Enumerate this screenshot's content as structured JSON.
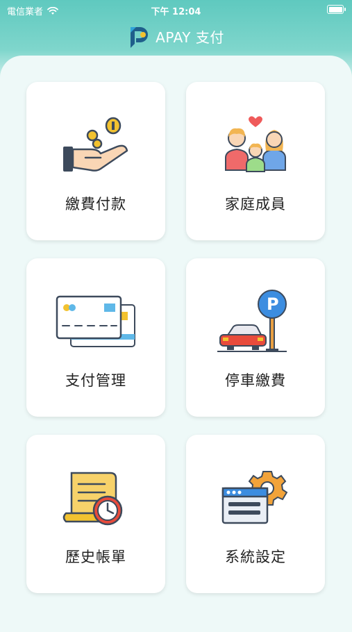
{
  "status_bar": {
    "carrier": "電信業者",
    "time": "下午 12:04"
  },
  "header": {
    "title": "APAY 支付"
  },
  "menu": {
    "items": [
      {
        "label": "繳費付款",
        "icon": "hand-coins-icon"
      },
      {
        "label": "家庭成員",
        "icon": "family-icon"
      },
      {
        "label": "支付管理",
        "icon": "credit-cards-icon"
      },
      {
        "label": "停車繳費",
        "icon": "parking-car-icon"
      },
      {
        "label": "歷史帳單",
        "icon": "bill-history-icon"
      },
      {
        "label": "系統設定",
        "icon": "settings-icon"
      }
    ]
  },
  "colors": {
    "header_gradient_top": "#5fc9bf",
    "panel_bg": "#eef9f8",
    "tile_bg": "#ffffff",
    "text": "#222222"
  }
}
